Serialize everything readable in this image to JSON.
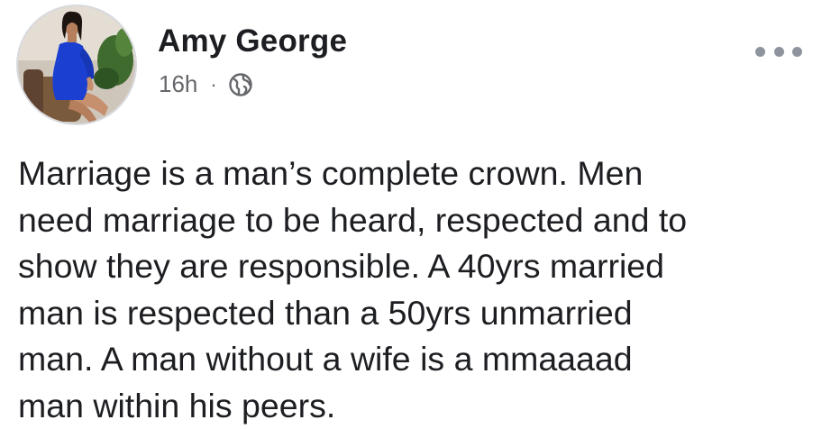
{
  "post": {
    "author": "Amy George",
    "time": "16h",
    "separator": "·",
    "privacy_icon": "globe-icon",
    "more_icon": "more-options-icon",
    "text_lines": [
      "Marriage is a man’s complete crown.  Men",
      "need marriage to be heard, respected and to",
      "show they are responsible. A 40yrs married",
      "man is respected than a 50yrs unmarried",
      "man. A man without a wife is a mmaaaad",
      "man within his peers."
    ]
  },
  "colors": {
    "text": "#1c1e21",
    "secondary_text": "#65676b",
    "icon_gray": "#8d949e",
    "outfit_blue": "#1a3fd1"
  }
}
